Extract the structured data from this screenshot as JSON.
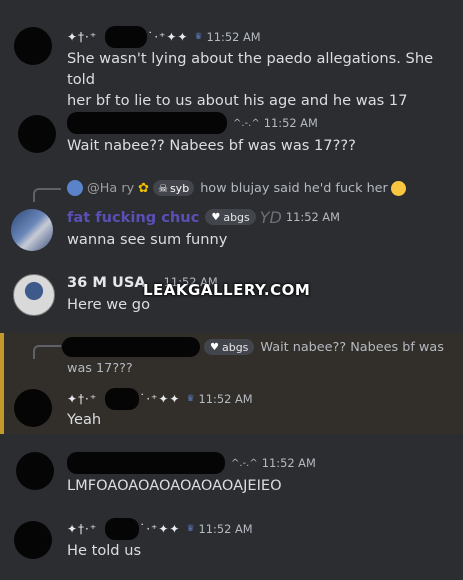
{
  "messages": [
    {
      "time": "11:52 AM",
      "stars_left": "✦†·⁺",
      "stars_right": "˙·⁺✦✦",
      "line1": "She wasn't lying about the paedo allegations. She told",
      "line2": "her bf to lie to us about his age and he was 17"
    },
    {
      "time": "11:52 AM",
      "caret": "^.-.^",
      "text": "Wait nabee?? Nabees bf was was 17???"
    },
    {
      "reply_handle": "@Ha  ry",
      "reply_tag": "syb",
      "reply_text": "how blujay said he'd fuck her",
      "username": "fat fucking chuc",
      "badge": "abgs",
      "extra": "YD",
      "time": "11:52 AM",
      "text": "wanna see sum funny"
    },
    {
      "username": "36 M USA",
      "time": "11:52 AM",
      "text": "Here we go"
    },
    {
      "reply_badge": "abgs",
      "reply_text_1": "Wait nabee?? Nabees bf was",
      "reply_text_2": "was 17???",
      "time": "11:52 AM",
      "stars_left": "✦†·⁺",
      "stars_right": "˙·⁺✦✦",
      "text": "Yeah"
    },
    {
      "time": "11:52 AM",
      "caret": "^.-.^",
      "text": "LMFOAOAOAOAOAOAOAJEIEO"
    },
    {
      "time": "11:52 AM",
      "stars_left": "✦†·⁺",
      "stars_right": "˙·⁺✦✦",
      "text": "He told us"
    }
  ],
  "watermark": "LEAKGALLERY.COM",
  "icons": {
    "crown": "crown-icon",
    "heart": "heart-icon",
    "sunflower": "sunflower-icon",
    "skull": "skull-icon",
    "crying": "crying-emoji-icon"
  }
}
